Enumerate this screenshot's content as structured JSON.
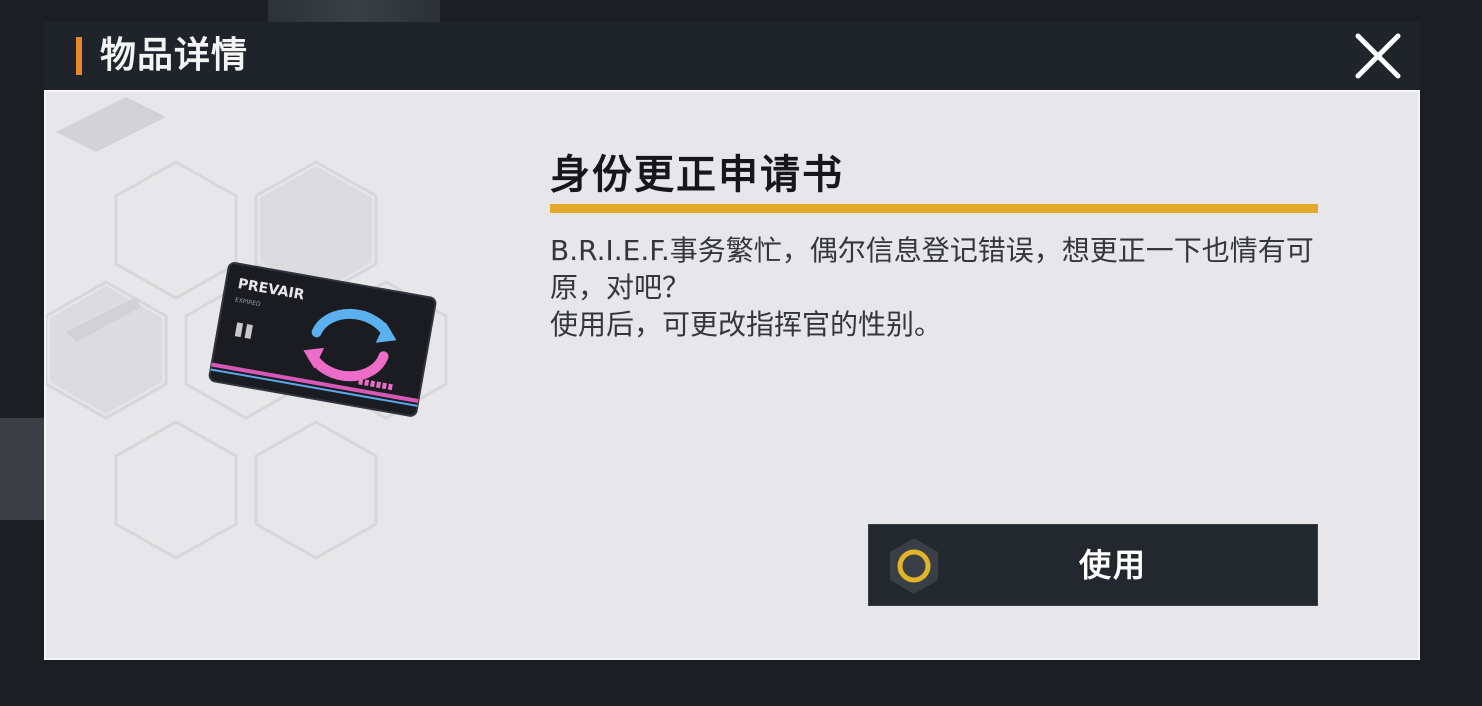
{
  "dialog": {
    "title": "物品详情"
  },
  "item": {
    "name": "身份更正申请书",
    "description_lines": [
      "B.R.I.E.F.事务繁忙，偶尔信息登记错误，想更正一下也情有可原，对吧？",
      "使用后，可更改指挥官的性别。"
    ],
    "card_logo_text": "PREVAIR",
    "card_sub_text": "EXPIRED"
  },
  "actions": {
    "use_label": "使用"
  },
  "colors": {
    "header_bg": "#1f232a",
    "accent_orange": "#e58a2c",
    "rule_yellow": "#e2a92a",
    "button_bg": "#23272e",
    "panel_bg": "#e7e7e9"
  },
  "icons": {
    "close": "close-icon",
    "use_button": "hex-ring-icon"
  }
}
